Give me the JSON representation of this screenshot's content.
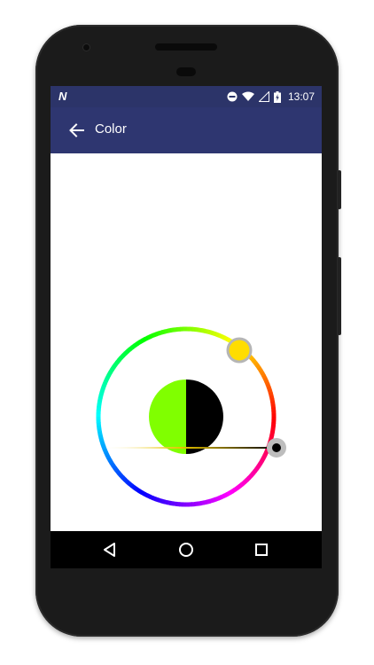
{
  "status_bar": {
    "notification_icon": "N",
    "time": "13:07",
    "icons": [
      "dnd-icon",
      "wifi-icon",
      "signal-icon",
      "battery-charging-icon"
    ]
  },
  "app_bar": {
    "title": "Color",
    "back_icon": "arrow-left-icon"
  },
  "color_picker": {
    "selected_color": "#80ff00",
    "previous_color": "#000000",
    "wheel_handle_color": "#ffdd00",
    "brightness_value": 1.0
  },
  "nav_bar": {
    "buttons": [
      "back-icon",
      "home-icon",
      "recents-icon"
    ]
  },
  "colors": {
    "status_bar": "#2c3469",
    "app_bar": "#2e3670",
    "phone_body": "#1b1b1b"
  }
}
